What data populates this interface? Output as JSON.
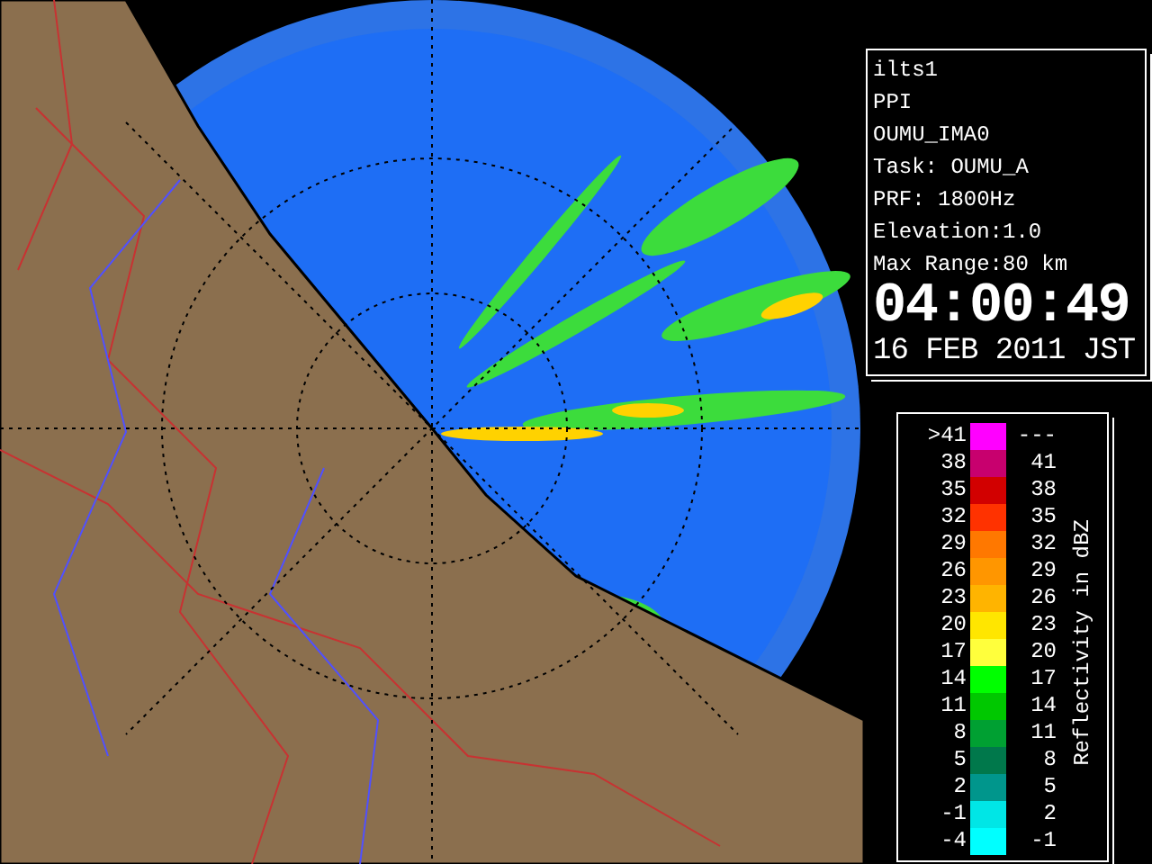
{
  "info": {
    "lines": [
      "ilts1",
      "PPI",
      "OUMU_IMA0",
      "Task: OUMU_A",
      "PRF: 1800Hz",
      "Elevation:1.0",
      "Max Range:80 km"
    ],
    "time": "04:00:49",
    "date": "16 FEB 2011 JST"
  },
  "legend": {
    "title": "Reflectivity in dBZ",
    "rows": [
      {
        "low": ">41",
        "high": "---",
        "color": "#ff00ff"
      },
      {
        "low": "38",
        "high": "41",
        "color": "#c8006e"
      },
      {
        "low": "35",
        "high": "38",
        "color": "#d20000"
      },
      {
        "low": "32",
        "high": "35",
        "color": "#ff3200"
      },
      {
        "low": "29",
        "high": "32",
        "color": "#ff7800"
      },
      {
        "low": "26",
        "high": "29",
        "color": "#ff9600"
      },
      {
        "low": "23",
        "high": "26",
        "color": "#ffb400"
      },
      {
        "low": "20",
        "high": "23",
        "color": "#ffe600"
      },
      {
        "low": "17",
        "high": "20",
        "color": "#ffff3c"
      },
      {
        "low": "14",
        "high": "17",
        "color": "#00ff00"
      },
      {
        "low": "11",
        "high": "14",
        "color": "#00c800"
      },
      {
        "low": "8",
        "high": "11",
        "color": "#00a032"
      },
      {
        "low": "5",
        "high": "8",
        "color": "#00784b"
      },
      {
        "low": "2",
        "high": "5",
        "color": "#00968c"
      },
      {
        "low": "-1",
        "high": "2",
        "color": "#00e6e6"
      },
      {
        "low": "-4",
        "high": "-1",
        "color": "#00ffff"
      }
    ]
  }
}
